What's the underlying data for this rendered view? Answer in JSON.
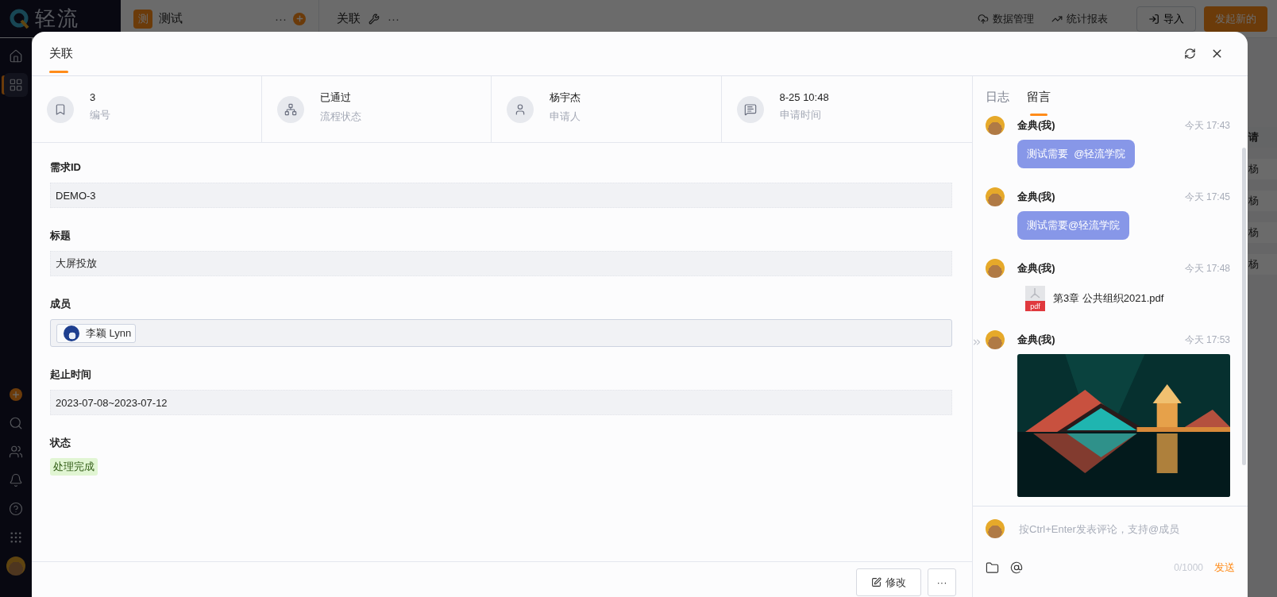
{
  "app": {
    "logo": "轻流",
    "app_badge": "测",
    "app_name": "测试",
    "app_more": "···",
    "view_title": "关联",
    "view_more": "···",
    "actions": [
      {
        "kind": "data",
        "label": "数据管理"
      },
      {
        "kind": "report",
        "label": "统计报表"
      }
    ],
    "import_button": "导入",
    "new_button": "发起新的",
    "nav": [
      {
        "kind": "home",
        "selected": false
      },
      {
        "kind": "apps",
        "selected": true
      },
      {
        "kind": "add",
        "selected": false
      },
      {
        "kind": "search",
        "selected": false
      },
      {
        "kind": "users",
        "selected": false
      },
      {
        "kind": "bell",
        "selected": false
      },
      {
        "kind": "help",
        "selected": false
      },
      {
        "kind": "grid",
        "selected": false
      },
      {
        "kind": "avatar",
        "selected": false
      }
    ],
    "table_header": "请",
    "table_cells": [
      "杨",
      "杨",
      "杨",
      "杨"
    ]
  },
  "modal": {
    "title": "关联",
    "summary": [
      {
        "kind": "id",
        "value": "3",
        "label": "编号"
      },
      {
        "kind": "flow",
        "value": "已通过",
        "label": "流程状态"
      },
      {
        "kind": "person",
        "value": "杨宇杰",
        "label": "申请人"
      },
      {
        "kind": "time",
        "value": "8-25 10:48",
        "label": "申请时间"
      }
    ],
    "fields": [
      {
        "kind": "text",
        "label": "需求ID",
        "value": "DEMO-3"
      },
      {
        "kind": "text",
        "label": "标题",
        "value": "大屏投放"
      },
      {
        "kind": "members",
        "label": "成员",
        "members": [
          "李颖 Lynn"
        ]
      },
      {
        "kind": "text",
        "label": "起止时间",
        "value": "2023-07-08~2023-07-12"
      },
      {
        "kind": "tag",
        "label": "状态",
        "value": "处理完成",
        "color": "#e1f5d3"
      }
    ],
    "footer_buttons": [
      {
        "kind": "edit",
        "label": "修改"
      },
      {
        "kind": "more",
        "label": "···"
      }
    ],
    "panel": {
      "tabs": [
        {
          "label": "日志",
          "selected": false
        },
        {
          "label": "留言",
          "selected": true
        }
      ],
      "comments": [
        {
          "kind": "text",
          "author": "金典(我)",
          "time": "今天 17:43",
          "text": "测试需要  @轻流学院"
        },
        {
          "kind": "text",
          "author": "金典(我)",
          "time": "今天 17:45",
          "text": "测试需要@轻流学院"
        },
        {
          "kind": "file",
          "author": "金典(我)",
          "time": "今天 17:48",
          "file_type": "pdf",
          "file_name": "第3章 公共组织2021.pdf"
        },
        {
          "author": "金典(我)",
          "time": "今天 17:53"
        }
      ],
      "composer": {
        "placeholder": "按Ctrl+Enter发表评论，支持@成员",
        "counter": "0/1000",
        "send": "发送"
      }
    }
  }
}
